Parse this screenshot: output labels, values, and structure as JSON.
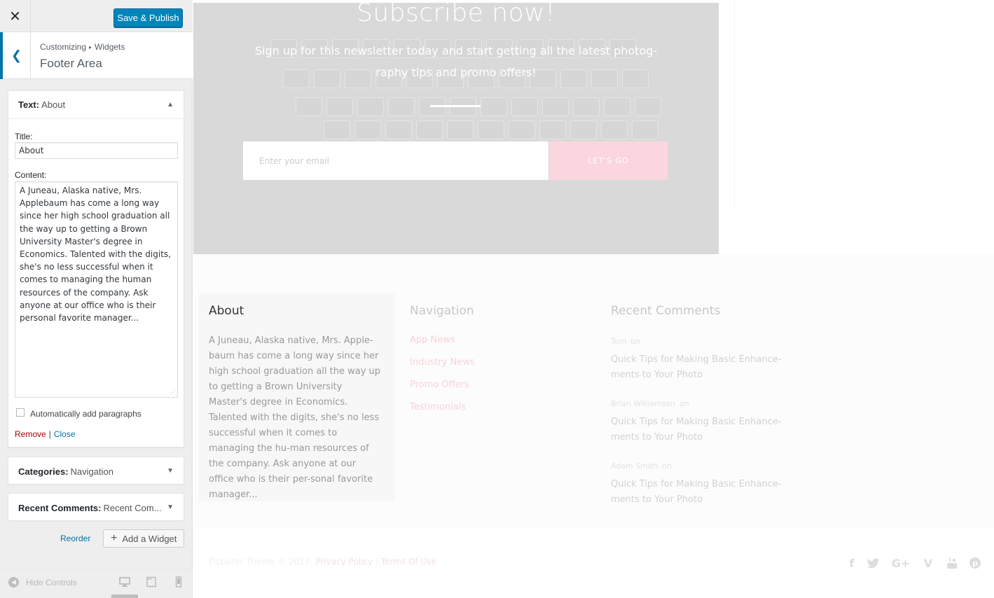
{
  "header": {
    "close_icon": "close-icon",
    "save_label": "Save & Publish"
  },
  "panel": {
    "breadcrumb_root": "Customizing",
    "breadcrumb_section": "Widgets",
    "title": "Footer Area"
  },
  "widgets": {
    "text": {
      "type": "Text:",
      "name": "About",
      "expanded": true,
      "title_label": "Title:",
      "title_value": "About",
      "content_label": "Content:",
      "content_value": "A Juneau, Alaska native, Mrs. Applebaum has come a long way since her high school graduation all the way up to getting a Brown University Master's degree in Economics. Talented with the digits, she's no less successful when it comes to managing the human resources of the company. Ask anyone at our office who is their personal favorite manager...",
      "autop_label": "Automatically add paragraphs",
      "autop_checked": false,
      "remove_label": "Remove",
      "separator": "|",
      "close_label": "Close"
    },
    "categories": {
      "type": "Categories:",
      "name": "Navigation"
    },
    "recent_comments": {
      "type": "Recent Comments:",
      "name": "Recent Com..."
    }
  },
  "actions": {
    "reorder_label": "Reorder",
    "add_widget_label": "Add a Widget"
  },
  "sidebar_footer": {
    "hide_controls_label": "Hide Controls",
    "devices": [
      "desktop",
      "tablet",
      "mobile"
    ],
    "active_device": "desktop"
  },
  "preview": {
    "subscribe": {
      "title": "Subscribe now!",
      "text": "Sign up for this newsletter today and start getting all the latest photog-raphy tips and promo offers!",
      "email_placeholder": "Enter your email",
      "button_label": "LET'S GO"
    },
    "footer": {
      "about_heading": "About",
      "about_text": "A Juneau, Alaska native, Mrs. Apple-baum has come a long way since her high school graduation all the way up to getting a Brown University Master's degree in Economics. Talented with the digits, she's no less successful when it comes to managing the hu-man resources of the company. Ask anyone at our office who is their per-sonal favorite manager...",
      "navigation_heading": "Navigation",
      "navigation_items": [
        "App News",
        "Industry News",
        "Promo Offers",
        "Testimonials"
      ],
      "recent_heading": "Recent Comments",
      "recent_comments": [
        {
          "author": "Tom",
          "on": "on",
          "post": "Quick Tips for Making Basic Enhance-ments to Your Photo"
        },
        {
          "author": "Brian Williamson",
          "on": "on",
          "post": "Quick Tips for Making Basic Enhance-ments to Your Photo"
        },
        {
          "author": "Adam Smith",
          "on": "on",
          "post": "Quick Tips for Making Basic Enhance-ments to Your Photo"
        }
      ],
      "copyright_text": "Pictalter Theme © 2017.",
      "privacy_label": "Privacy Policy",
      "legal_sep": "|",
      "terms_label": "Terms Of Use",
      "social_icons": [
        "facebook-icon",
        "twitter-icon",
        "google-plus-icon",
        "vimeo-icon",
        "youtube-icon",
        "pinterest-icon"
      ]
    }
  },
  "colors": {
    "wp_blue": "#0085ba",
    "link_blue": "#0073aa",
    "remove_red": "#aa0000",
    "pink_button": "#fbd6de",
    "hero_overlay": "#d9d9d9"
  }
}
